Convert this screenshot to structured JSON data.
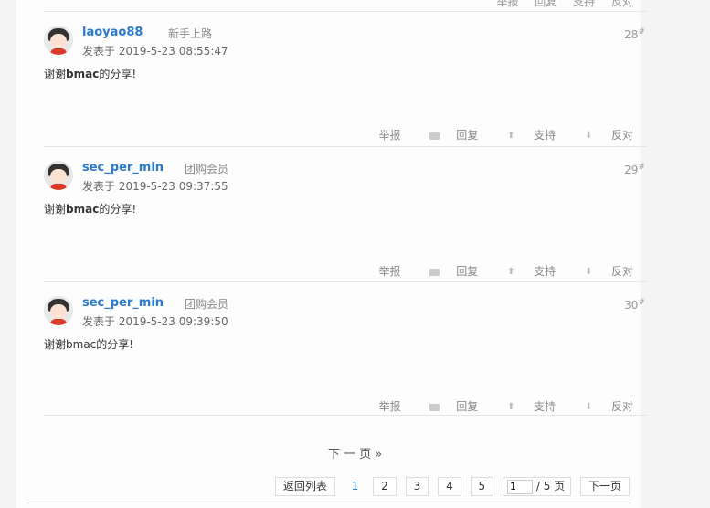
{
  "top_actions": [
    "举报",
    "回复",
    "支持",
    "反对"
  ],
  "posts": [
    {
      "username": "laoyao88",
      "group": "新手上路",
      "time": "发表于 2019-5-23 08:55:47",
      "floor": "28",
      "floor_mark": "#",
      "content_prefix": "谢谢",
      "content_bold": "bmac",
      "content_suffix": "的分享!"
    },
    {
      "username": "sec_per_min",
      "group": "团购会员",
      "time": "发表于 2019-5-23 09:37:55",
      "floor": "29",
      "floor_mark": "#",
      "content_prefix": "谢谢",
      "content_bold": "bmac",
      "content_suffix": "的分享!"
    },
    {
      "username": "sec_per_min",
      "group": "团购会员",
      "time": "发表于 2019-5-23 09:39:50",
      "floor": "30",
      "floor_mark": "#",
      "content_prefix": "谢谢",
      "content_bold": "",
      "content_suffix": "bmac的分享!"
    }
  ],
  "actions": {
    "report": "举报",
    "reply": "回复",
    "support": "支持",
    "oppose": "反对"
  },
  "pagination": {
    "next_link": "下 一 页  »",
    "back_to_list": "返回列表",
    "current": "1",
    "pages": [
      "2",
      "3",
      "4",
      "5"
    ],
    "jump_value": "1",
    "total": "/ 5 页",
    "next": "下一页"
  },
  "colors": {
    "link": "#2b7acc",
    "background": "#f4f4f4"
  }
}
